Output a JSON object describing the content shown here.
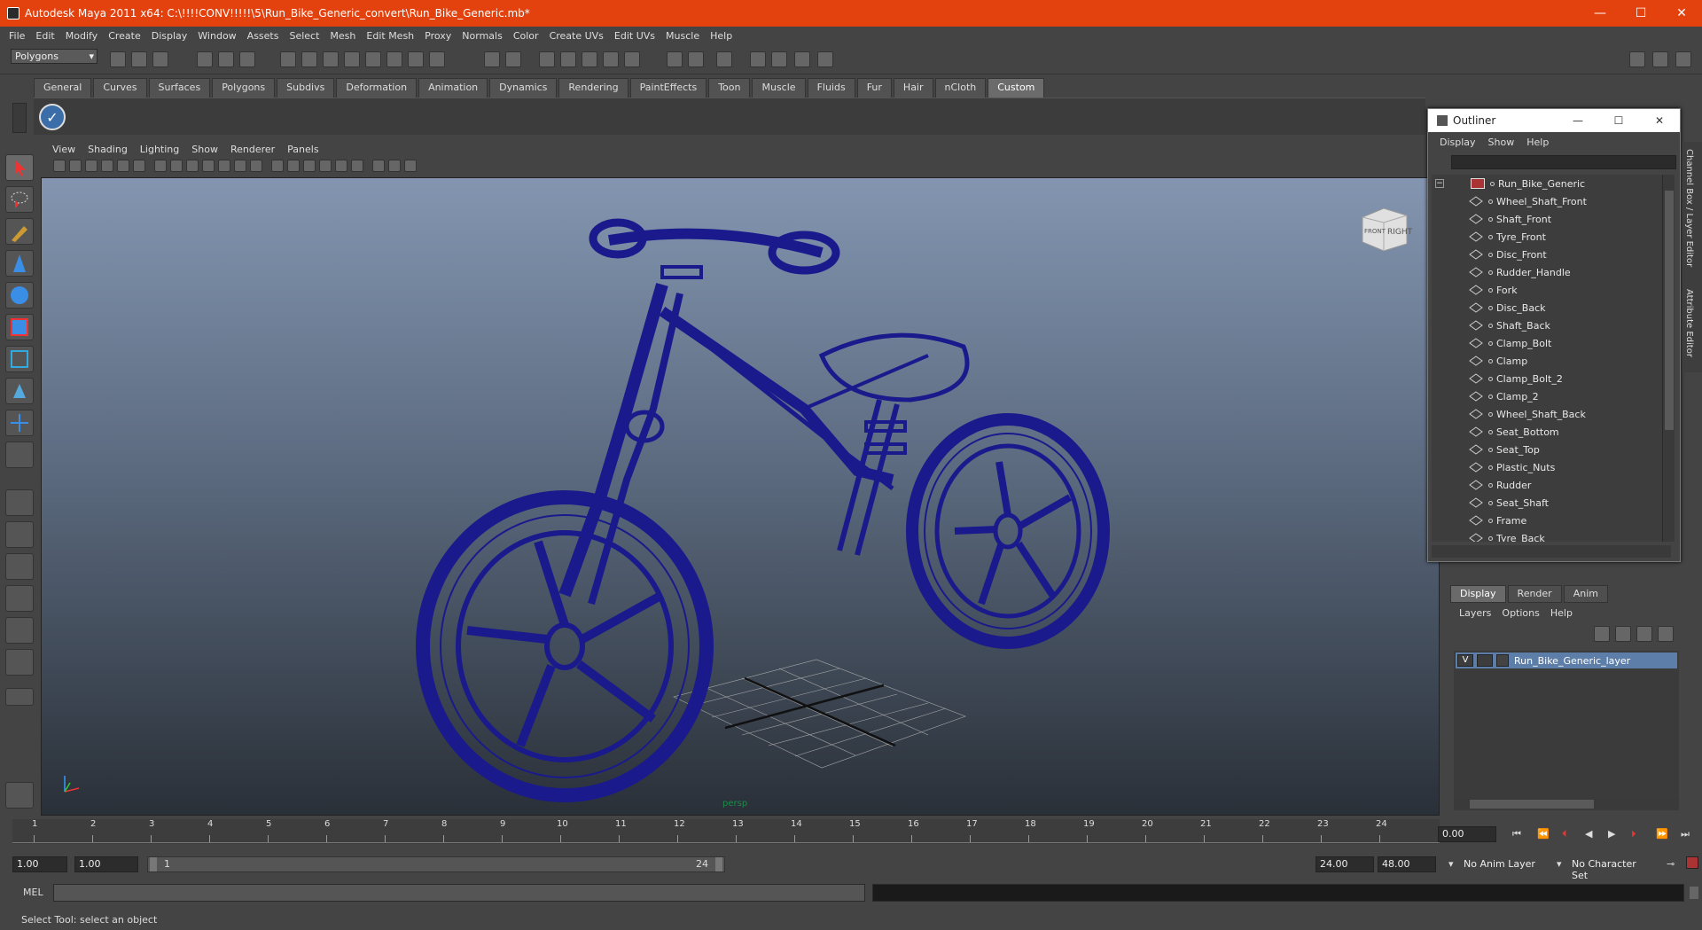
{
  "window": {
    "title": "Autodesk Maya 2011 x64: C:\\!!!!CONV!!!!!\\5\\Run_Bike_Generic_convert\\Run_Bike_Generic.mb*",
    "minimize": "—",
    "maximize": "☐",
    "close": "✕"
  },
  "menubar": [
    "File",
    "Edit",
    "Modify",
    "Create",
    "Display",
    "Window",
    "Assets",
    "Select",
    "Mesh",
    "Edit Mesh",
    "Proxy",
    "Normals",
    "Color",
    "Create UVs",
    "Edit UVs",
    "Muscle",
    "Help"
  ],
  "mode_selector": "Polygons",
  "shelf_tabs": [
    "General",
    "Curves",
    "Surfaces",
    "Polygons",
    "Subdivs",
    "Deformation",
    "Animation",
    "Dynamics",
    "Rendering",
    "PaintEffects",
    "Toon",
    "Muscle",
    "Fluids",
    "Fur",
    "Hair",
    "nCloth",
    "Custom"
  ],
  "active_shelf": "Custom",
  "viewport": {
    "menu": [
      "View",
      "Shading",
      "Lighting",
      "Show",
      "Renderer",
      "Panels"
    ],
    "camera_label": "persp",
    "viewcube": {
      "front": "FRONT",
      "right": "RIGHT"
    },
    "wire_color": "#1a1a8c"
  },
  "outliner": {
    "title": "Outliner",
    "menu": [
      "Display",
      "Show",
      "Help"
    ],
    "root": "Run_Bike_Generic",
    "items": [
      "Wheel_Shaft_Front",
      "Shaft_Front",
      "Tyre_Front",
      "Disc_Front",
      "Rudder_Handle",
      "Fork",
      "Disc_Back",
      "Shaft_Back",
      "Clamp_Bolt",
      "Clamp",
      "Clamp_Bolt_2",
      "Clamp_2",
      "Wheel_Shaft_Back",
      "Seat_Bottom",
      "Seat_Top",
      "Plastic_Nuts",
      "Rudder",
      "Seat_Shaft",
      "Frame",
      "Tyre_Back"
    ]
  },
  "side_tabs": [
    "Channel Box / Layer Editor",
    "Attribute Editor"
  ],
  "layer_editor": {
    "tabs": [
      "Display",
      "Render",
      "Anim"
    ],
    "active_tab": "Display",
    "menu": [
      "Layers",
      "Options",
      "Help"
    ],
    "layer": {
      "visible": "V",
      "name": "Run_Bike_Generic_layer"
    },
    "selected_color": "#5d7ea8"
  },
  "timeline": {
    "ticks": [
      "1",
      "2",
      "3",
      "4",
      "5",
      "6",
      "7",
      "8",
      "9",
      "10",
      "11",
      "12",
      "13",
      "14",
      "15",
      "16",
      "17",
      "18",
      "19",
      "20",
      "21",
      "22",
      "23",
      "24"
    ],
    "current_time": "0.00"
  },
  "range": {
    "start": "1.00",
    "playback_start": "1.00",
    "slider_start": "1",
    "slider_end": "24",
    "playback_end": "24.00",
    "end": "48.00",
    "anim_layer": "No Anim Layer",
    "character_set": "No Character Set"
  },
  "mel": {
    "label": "MEL"
  },
  "status": "Select Tool: select an object"
}
